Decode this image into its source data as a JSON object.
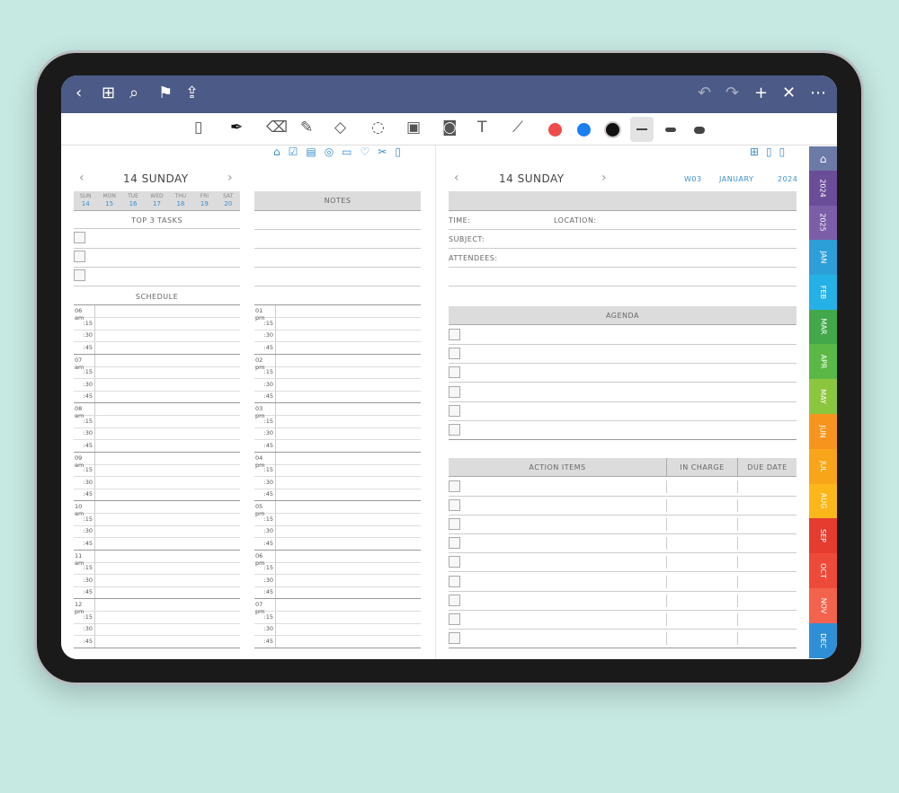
{
  "nav": {
    "back": "‹",
    "grid": "⊞",
    "search": "⌕",
    "bookmark": "⚑",
    "share": "⇪",
    "undo": "↶",
    "redo": "↷",
    "add": "+",
    "close": "✕",
    "more": "⋯"
  },
  "colors": {
    "red": "#ef4b4b",
    "blue": "#1a7ff0",
    "black": "#111111",
    "nav": "#4b5a86"
  },
  "left": {
    "day_title": "14 SUNDAY",
    "prev": "‹",
    "next": "›",
    "week": [
      {
        "d": "SUN",
        "n": "14"
      },
      {
        "d": "MON",
        "n": "15"
      },
      {
        "d": "TUE",
        "n": "16"
      },
      {
        "d": "WED",
        "n": "17"
      },
      {
        "d": "THU",
        "n": "18"
      },
      {
        "d": "FRI",
        "n": "19"
      },
      {
        "d": "SAT",
        "n": "20"
      }
    ],
    "top_tasks": "TOP 3 TASKS",
    "schedule": "SCHEDULE",
    "notes": "NOTES",
    "hours_am": [
      "06 am",
      "07 am",
      "08 am",
      "09 am",
      "10 am",
      "11 am",
      "12 pm"
    ],
    "hours_pm": [
      "01 pm",
      "02 pm",
      "03 pm",
      "04 pm",
      "05 pm",
      "06 pm",
      "07 pm"
    ],
    "quarters": [
      ":15",
      ":30",
      ":45"
    ]
  },
  "right": {
    "day_title": "14 SUNDAY",
    "prev": "‹",
    "next": "›",
    "week": "W03",
    "month": "JANUARY",
    "year": "2024",
    "time": "TIME:",
    "location": "LOCATION:",
    "subject": "SUBJECT:",
    "attendees": "ATTENDEES:",
    "agenda": "AGENDA",
    "action_items": "ACTION ITEMS",
    "in_charge": "IN CHARGE",
    "due_date": "DUE DATE"
  },
  "tabs": [
    {
      "label": "⌂",
      "color": "#6c7aa6"
    },
    {
      "label": "2024",
      "color": "#6a4d99"
    },
    {
      "label": "2025",
      "color": "#7b5ea8"
    },
    {
      "label": "JAN",
      "color": "#2d9fd8"
    },
    {
      "label": "FEB",
      "color": "#25b0e6"
    },
    {
      "label": "MAR",
      "color": "#43a84a"
    },
    {
      "label": "APR",
      "color": "#5cb846"
    },
    {
      "label": "MAY",
      "color": "#8cc63f"
    },
    {
      "label": "JUN",
      "color": "#f7941d"
    },
    {
      "label": "JUL",
      "color": "#f9a51a"
    },
    {
      "label": "AUG",
      "color": "#fbb71a"
    },
    {
      "label": "SEP",
      "color": "#e53c2f"
    },
    {
      "label": "OCT",
      "color": "#ee4a3a"
    },
    {
      "label": "NOV",
      "color": "#f2624d"
    },
    {
      "label": "DEC",
      "color": "#2e8fd6"
    }
  ]
}
